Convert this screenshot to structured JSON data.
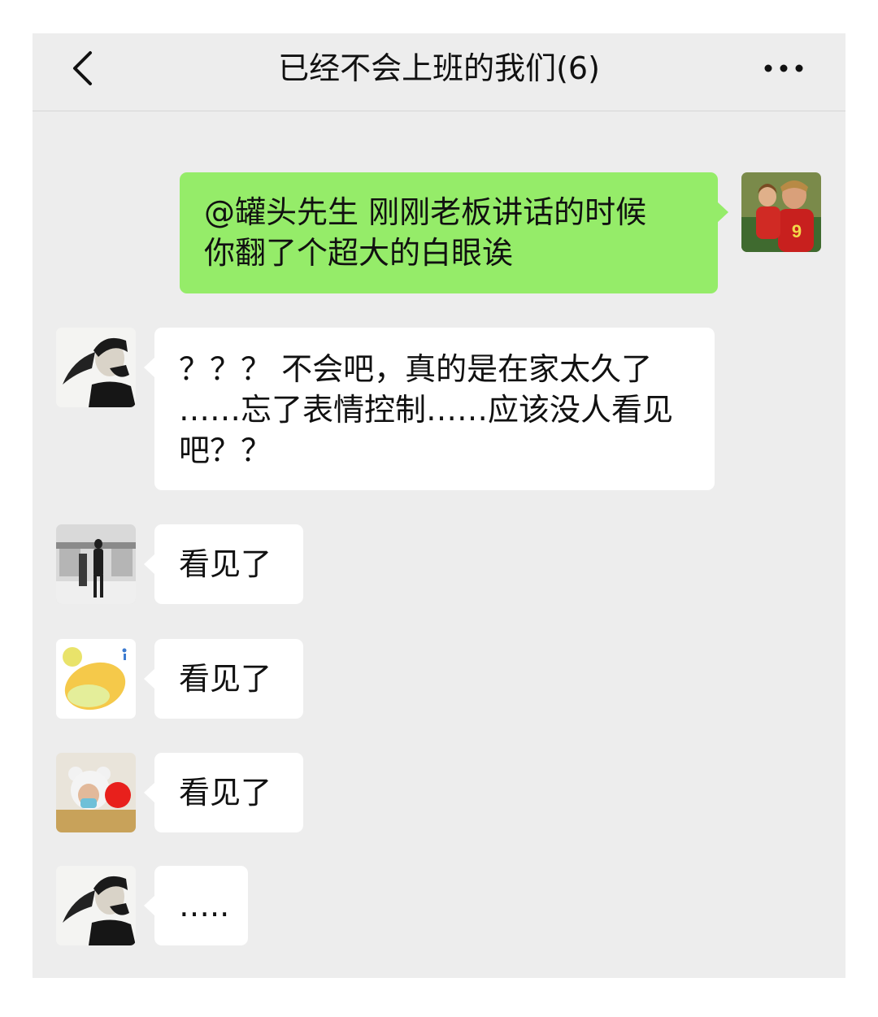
{
  "header": {
    "title": "已经不会上班的我们(6)",
    "back_icon": "chevron-left-icon",
    "more_icon": "more-dots-icon"
  },
  "colors": {
    "chat_background": "#ededed",
    "outgoing_bubble": "#95ec69",
    "incoming_bubble": "#ffffff",
    "text": "#111111"
  },
  "messages": [
    {
      "sender": "self",
      "lines": [
        "@罐头先生  刚刚老板讲话的时候",
        "你翻了个超大的白眼诶"
      ]
    },
    {
      "sender": "member",
      "lines": [
        "？？？ 不会吧，真的是在家太久了",
        "……忘了表情控制……应该没人看见",
        "吧？？"
      ]
    },
    {
      "sender": "member",
      "lines": [
        "看见了"
      ]
    },
    {
      "sender": "member",
      "lines": [
        "看见了"
      ]
    },
    {
      "sender": "member",
      "lines": [
        "看见了"
      ]
    },
    {
      "sender": "member",
      "lines": [
        "….."
      ]
    }
  ]
}
